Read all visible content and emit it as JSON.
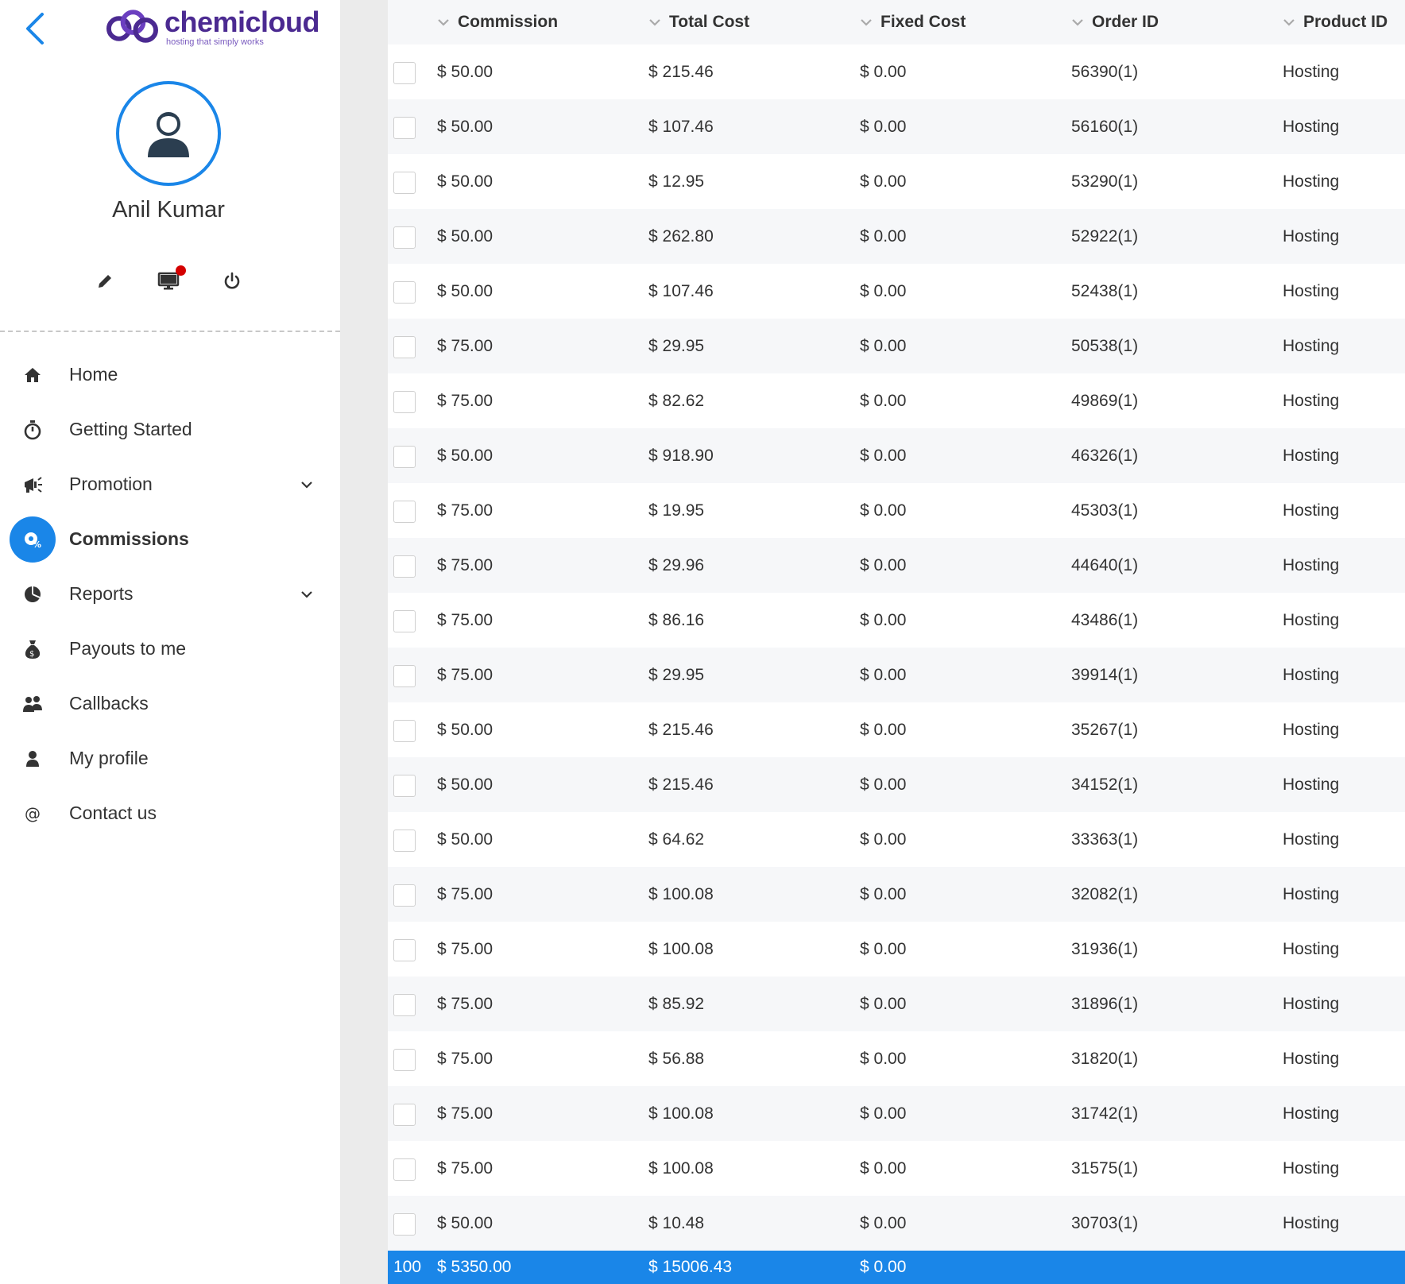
{
  "brand": {
    "name": "chemicloud",
    "tagline": "hosting that simply works",
    "colors": {
      "primary": "#1a86e8",
      "brand_purple": "#4b2a91",
      "notify": "#d40000"
    }
  },
  "user": {
    "name": "Anil Kumar"
  },
  "profile_actions": [
    {
      "icon": "pencil-icon"
    },
    {
      "icon": "monitor-icon",
      "has_notification": true
    },
    {
      "icon": "power-icon"
    }
  ],
  "nav": {
    "items": [
      {
        "label": "Home",
        "icon": "home-icon",
        "active": false,
        "has_submenu": false
      },
      {
        "label": "Getting Started",
        "icon": "stopwatch-icon",
        "active": false,
        "has_submenu": false
      },
      {
        "label": "Promotion",
        "icon": "megaphone-icon",
        "active": false,
        "has_submenu": true
      },
      {
        "label": "Commissions",
        "icon": "commission-icon",
        "active": true,
        "has_submenu": false
      },
      {
        "label": "Reports",
        "icon": "pie-chart-icon",
        "active": false,
        "has_submenu": true
      },
      {
        "label": "Payouts to me",
        "icon": "money-bag-icon",
        "active": false,
        "has_submenu": false
      },
      {
        "label": "Callbacks",
        "icon": "users-icon",
        "active": false,
        "has_submenu": false
      },
      {
        "label": "My profile",
        "icon": "user-icon",
        "active": false,
        "has_submenu": false
      },
      {
        "label": "Contact us",
        "icon": "at-icon",
        "active": false,
        "has_submenu": false
      }
    ]
  },
  "table": {
    "columns": [
      "Commission",
      "Total Cost",
      "Fixed Cost",
      "Order ID",
      "Product ID"
    ],
    "rows": [
      [
        "$ 50.00",
        "$ 215.46",
        "$ 0.00",
        "56390(1)",
        "Hosting"
      ],
      [
        "$ 50.00",
        "$ 107.46",
        "$ 0.00",
        "56160(1)",
        "Hosting"
      ],
      [
        "$ 50.00",
        "$ 12.95",
        "$ 0.00",
        "53290(1)",
        "Hosting"
      ],
      [
        "$ 50.00",
        "$ 262.80",
        "$ 0.00",
        "52922(1)",
        "Hosting"
      ],
      [
        "$ 50.00",
        "$ 107.46",
        "$ 0.00",
        "52438(1)",
        "Hosting"
      ],
      [
        "$ 75.00",
        "$ 29.95",
        "$ 0.00",
        "50538(1)",
        "Hosting"
      ],
      [
        "$ 75.00",
        "$ 82.62",
        "$ 0.00",
        "49869(1)",
        "Hosting"
      ],
      [
        "$ 50.00",
        "$ 918.90",
        "$ 0.00",
        "46326(1)",
        "Hosting"
      ],
      [
        "$ 75.00",
        "$ 19.95",
        "$ 0.00",
        "45303(1)",
        "Hosting"
      ],
      [
        "$ 75.00",
        "$ 29.96",
        "$ 0.00",
        "44640(1)",
        "Hosting"
      ],
      [
        "$ 75.00",
        "$ 86.16",
        "$ 0.00",
        "43486(1)",
        "Hosting"
      ],
      [
        "$ 75.00",
        "$ 29.95",
        "$ 0.00",
        "39914(1)",
        "Hosting"
      ],
      [
        "$ 50.00",
        "$ 215.46",
        "$ 0.00",
        "35267(1)",
        "Hosting"
      ],
      [
        "$ 50.00",
        "$ 215.46",
        "$ 0.00",
        "34152(1)",
        "Hosting"
      ],
      [
        "$ 50.00",
        "$ 64.62",
        "$ 0.00",
        "33363(1)",
        "Hosting"
      ],
      [
        "$ 75.00",
        "$ 100.08",
        "$ 0.00",
        "32082(1)",
        "Hosting"
      ],
      [
        "$ 75.00",
        "$ 100.08",
        "$ 0.00",
        "31936(1)",
        "Hosting"
      ],
      [
        "$ 75.00",
        "$ 85.92",
        "$ 0.00",
        "31896(1)",
        "Hosting"
      ],
      [
        "$ 75.00",
        "$ 56.88",
        "$ 0.00",
        "31820(1)",
        "Hosting"
      ],
      [
        "$ 75.00",
        "$ 100.08",
        "$ 0.00",
        "31742(1)",
        "Hosting"
      ],
      [
        "$ 75.00",
        "$ 100.08",
        "$ 0.00",
        "31575(1)",
        "Hosting"
      ],
      [
        "$ 50.00",
        "$ 10.48",
        "$ 0.00",
        "30703(1)",
        "Hosting"
      ]
    ],
    "totals": {
      "count": "100",
      "commission": "$ 5350.00",
      "total_cost": "$ 15006.43",
      "fixed_cost": "$ 0.00"
    }
  }
}
